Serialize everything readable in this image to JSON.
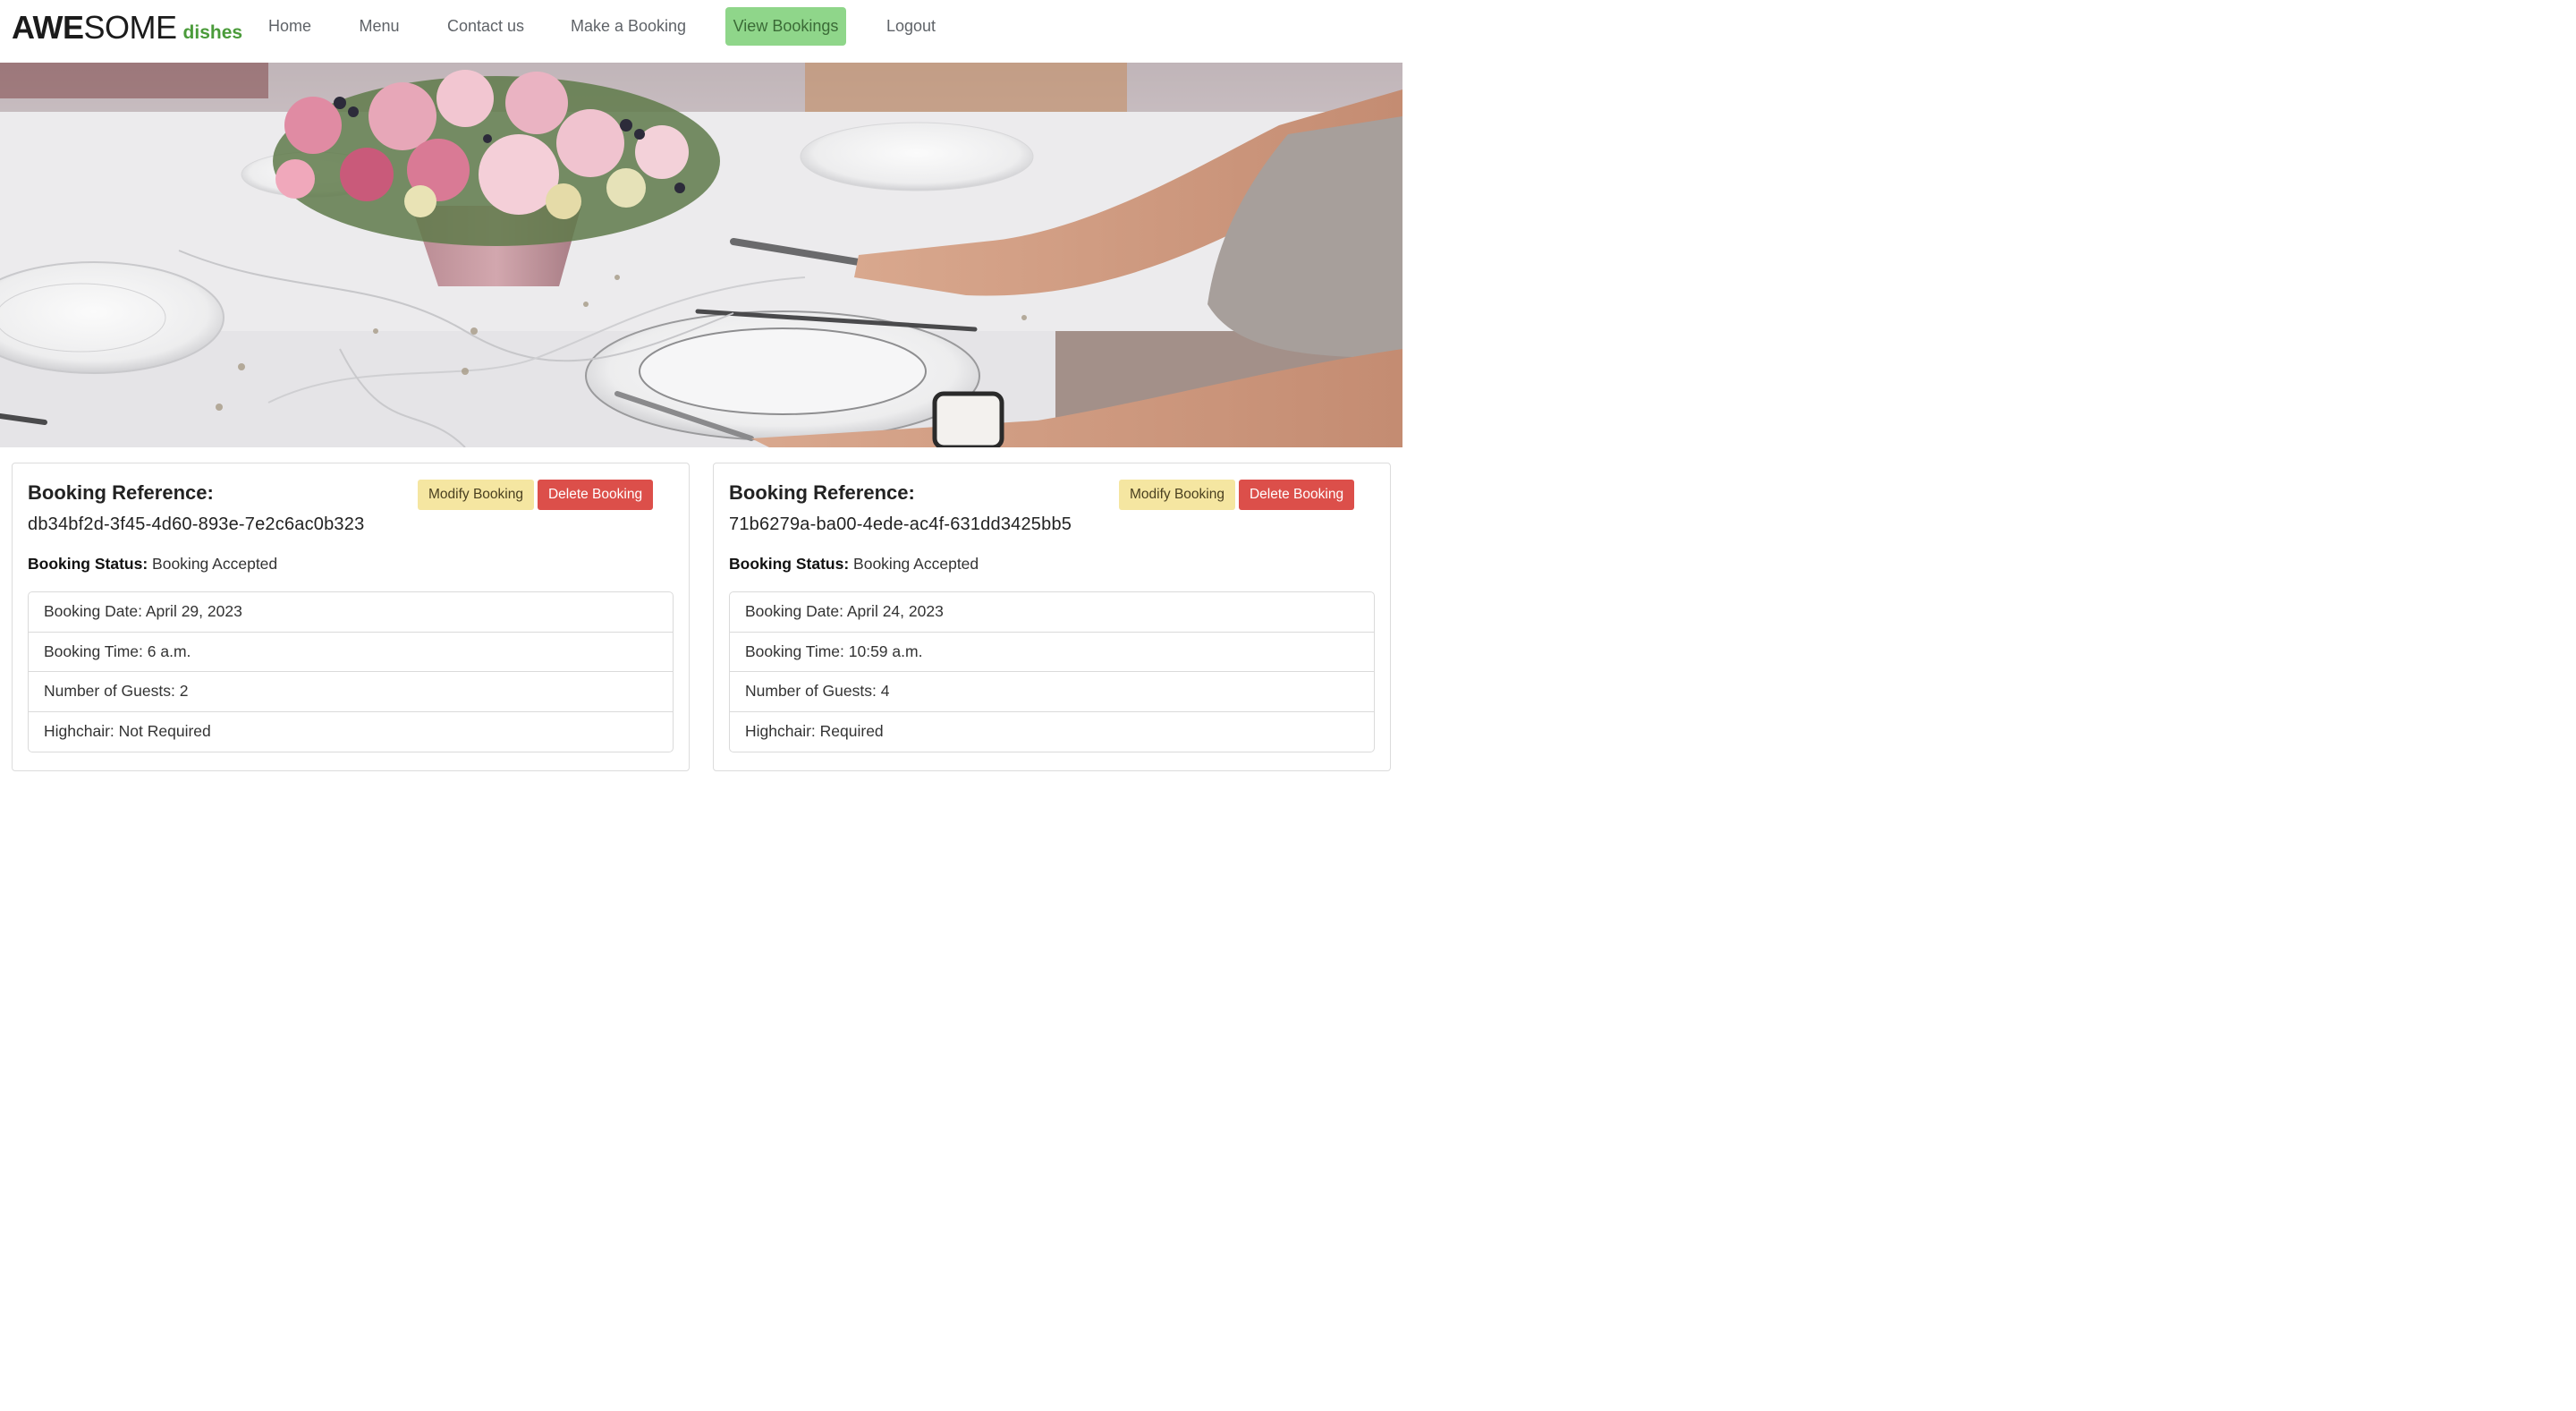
{
  "brand": {
    "main_bold": "AWE",
    "main_rest": "SOME",
    "sub": "dishes"
  },
  "nav": [
    {
      "label": "Home",
      "active": false
    },
    {
      "label": "Menu",
      "active": false
    },
    {
      "label": "Contact us",
      "active": false
    },
    {
      "label": "Make a Booking",
      "active": false
    },
    {
      "label": "View Bookings",
      "active": true
    },
    {
      "label": "Logout",
      "active": false
    }
  ],
  "bookings": [
    {
      "ref_label": "Booking Reference:",
      "reference": "db34bf2d-3f45-4d60-893e-7e2c6ac0b323",
      "modify_label": "Modify Booking",
      "delete_label": "Delete Booking",
      "status_label": "Booking Status:",
      "status": "Booking Accepted",
      "details": [
        "Booking Date: April 29, 2023",
        "Booking Time: 6 a.m.",
        "Number of Guests: 2",
        "Highchair: Not Required"
      ]
    },
    {
      "ref_label": "Booking Reference:",
      "reference": "71b6279a-ba00-4ede-ac4f-631dd3425bb5",
      "modify_label": "Modify Booking",
      "delete_label": "Delete Booking",
      "status_label": "Booking Status:",
      "status": "Booking Accepted",
      "details": [
        "Booking Date: April 24, 2023",
        "Booking Time: 10:59 a.m.",
        "Number of Guests: 4",
        "Highchair: Required"
      ]
    }
  ],
  "colors": {
    "brand_green": "#4a9b3a",
    "active_nav_bg": "#8fd68a",
    "modify_bg": "#f5e6a1",
    "delete_bg": "#dc4f4a"
  }
}
